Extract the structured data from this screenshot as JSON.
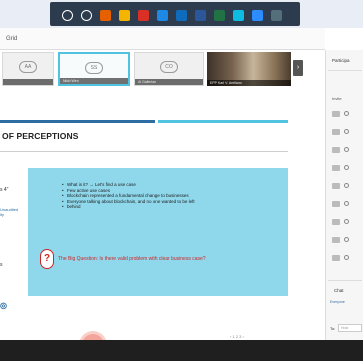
{
  "taskbar": {
    "icons": [
      {
        "name": "start-icon",
        "color": "#ffffff"
      },
      {
        "name": "search-icon",
        "color": "#ffffff"
      },
      {
        "name": "firefox-icon",
        "color": "#e66000"
      },
      {
        "name": "chrome-icon",
        "color": "#f4b400"
      },
      {
        "name": "app-red-icon",
        "color": "#d93025"
      },
      {
        "name": "app-blue-icon",
        "color": "#1e88e5"
      },
      {
        "name": "outlook-icon",
        "color": "#0f6cbd"
      },
      {
        "name": "word-icon",
        "color": "#2b579a"
      },
      {
        "name": "excel-icon",
        "color": "#217346"
      },
      {
        "name": "edge-icon",
        "color": "#0dbce0"
      },
      {
        "name": "zoom-icon",
        "color": "#2d8cff"
      },
      {
        "name": "app-icon",
        "color": "#546e7a"
      }
    ]
  },
  "topbar": {
    "title": "Grid"
  },
  "strip": {
    "tiles": [
      {
        "initials": "AA",
        "name": "",
        "selected": false
      },
      {
        "initials": "SS",
        "name": "Nikki Wen",
        "selected": true
      },
      {
        "initials": "CO",
        "name": "Al Gallerian",
        "selected": false
      }
    ],
    "photo_name": "EPP Karl V. Arellano",
    "next": "›"
  },
  "slide": {
    "title": "OF PERCEPTIONS",
    "left_text_1": "s 4\"",
    "left_link_1": "Unaudited",
    "left_link_2": "ity",
    "left_text_2": "s",
    "left_sub": "",
    "left_icon": "◎",
    "bullets": [
      "What is it? → Let's find a use case",
      "Few active use cases",
      "Blockchain represented a fundamental change to businesses",
      "Everyone talking about blockchain, and no one wanted to be left",
      "behind"
    ],
    "question_mark": "?",
    "question": "The Big Question: Is there valid problem with clear business case?"
  },
  "controls": {
    "slide_nav": "‹ 1 2 3 ›"
  },
  "panel": {
    "header": "Participa",
    "invite": "Invite",
    "participants": [
      "",
      "",
      "",
      "",
      "",
      "",
      "",
      "",
      ""
    ],
    "chat_header": "Chat",
    "everyone": "Everyone",
    "to_label": "To:",
    "to_placeholder": "Host"
  },
  "colors": {
    "accent": "#4fc3e0",
    "slide_blue": "#2e6da4",
    "content_box": "#8fd8ec",
    "question_red": "#d02424",
    "record": "#f4a59b"
  }
}
